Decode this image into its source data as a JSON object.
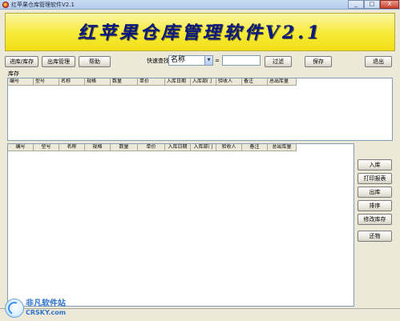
{
  "window": {
    "title": "红苹果仓库管理软件V2.1",
    "minimize": "_",
    "maximize": "□",
    "close": "X"
  },
  "banner": {
    "title": "红苹果仓库管理软件V2.1"
  },
  "toolbar": {
    "stock_in_out": "进库/库存",
    "stock_out_mgmt": "出库管理",
    "help": "帮助",
    "quick_search_label": "快速查找",
    "search_field_value": "名称",
    "equals": "=",
    "search_value": "",
    "filter": "过滤",
    "save": "保存",
    "exit": "退出"
  },
  "inventory": {
    "section_label": "库存",
    "columns": [
      "编号",
      "型号",
      "名称",
      "规格",
      "数量",
      "单价",
      "入库日期",
      "入库部门",
      "验收人",
      "备注",
      "总出库量"
    ]
  },
  "lower_table": {
    "columns": [
      "编号",
      "型号",
      "名称",
      "规格",
      "数量",
      "单价",
      "入库日期",
      "入库部门",
      "验收人",
      "备注",
      "总出库量"
    ]
  },
  "side_actions": {
    "stock_in": "入库",
    "print_report": "打印报表",
    "stock_out": "出库",
    "sort": "排序",
    "modify_stock": "修改库存",
    "return_goods": "还物"
  },
  "watermark": {
    "name": "非凡软件站",
    "url": "CRSKY.com"
  }
}
